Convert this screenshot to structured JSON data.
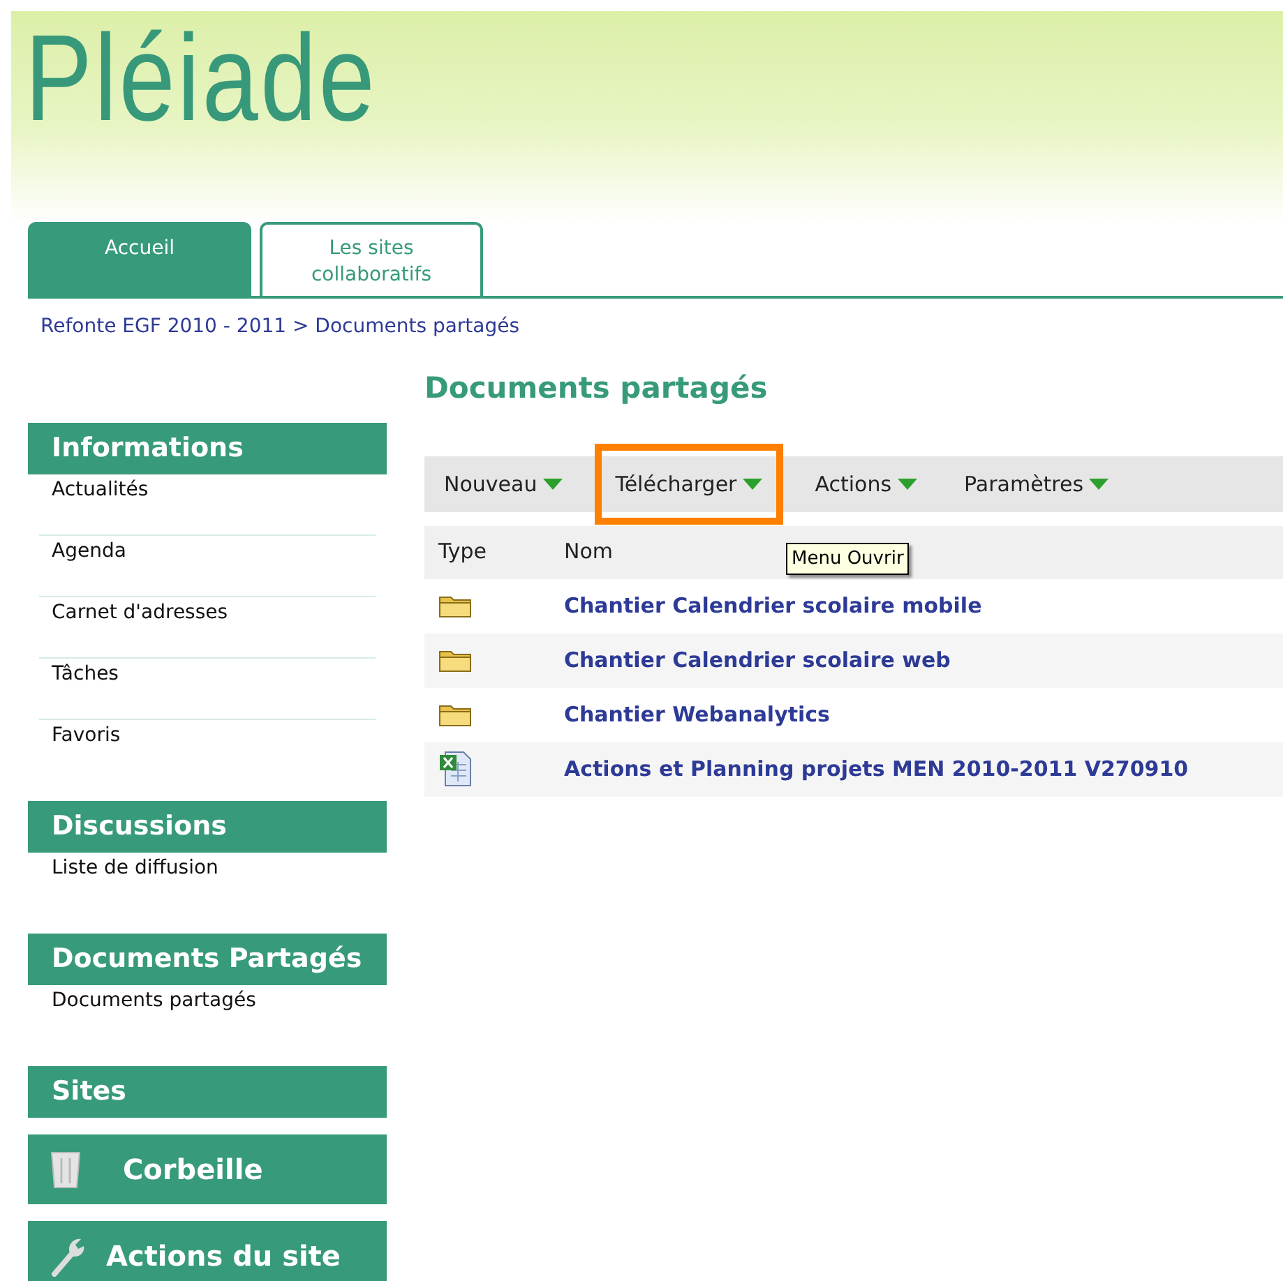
{
  "logo": "Pléiade",
  "tabs": [
    {
      "label": "Accueil",
      "selected": true
    },
    {
      "label": "Les sites collaboratifs",
      "selected": false
    }
  ],
  "breadcrumb": "Refonte EGF 2010 - 2011 > Documents partagés",
  "page_title": "Documents partagés",
  "sidebar": [
    {
      "kind": "list",
      "title": "Informations",
      "items": [
        "Actualités",
        "Agenda",
        "Carnet d'adresses",
        "Tâches",
        "Favoris"
      ]
    },
    {
      "kind": "list",
      "title": "Discussions",
      "items": [
        "Liste de diffusion"
      ]
    },
    {
      "kind": "list",
      "title": "Documents Partagés",
      "items": [
        "Documents partagés"
      ]
    },
    {
      "kind": "list",
      "title": "Sites"
    },
    {
      "kind": "trash",
      "title": "Corbeille"
    },
    {
      "kind": "wrench",
      "title": "Actions du site"
    }
  ],
  "toolbar": [
    {
      "label": "Nouveau",
      "highlighted": false
    },
    {
      "label": "Télécharger",
      "highlighted": true
    },
    {
      "label": "Actions",
      "highlighted": false
    },
    {
      "label": "Paramètres",
      "highlighted": false
    }
  ],
  "tooltip": "Menu Ouvrir",
  "table": {
    "columns": [
      "Type",
      "Nom"
    ],
    "rows": [
      {
        "kind": "folder",
        "name": "Chantier Calendrier scolaire mobile"
      },
      {
        "kind": "folder",
        "name": "Chantier Calendrier scolaire web"
      },
      {
        "kind": "folder",
        "name": "Chantier Webanalytics"
      },
      {
        "kind": "excel",
        "name": "Actions et Planning projets MEN 2010-2011 V270910"
      }
    ]
  }
}
